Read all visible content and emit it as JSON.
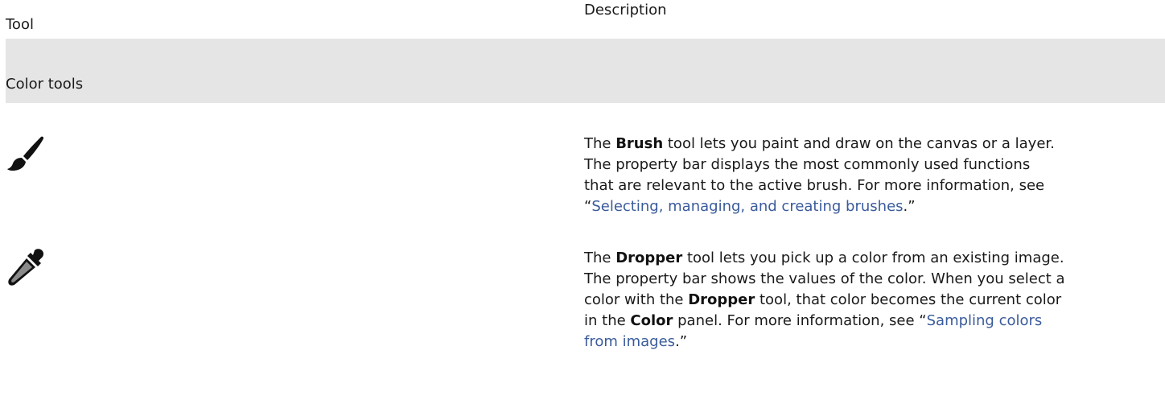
{
  "table": {
    "headers": {
      "tool": "Tool",
      "description": "Description"
    },
    "section": {
      "title": "Color tools"
    },
    "rows": [
      {
        "icon": "brush-icon",
        "lines": [
          {
            "pre": "The ",
            "tool": "Brush",
            "post": " tool lets you paint and draw on the canvas or a layer."
          },
          {
            "text": "The property bar displays the most commonly used functions"
          },
          {
            "text": "that are relevant to the active brush. For more information, see"
          },
          {
            "pre": "“",
            "link": "Selecting, managing, and creating brushes",
            "post": ".”"
          }
        ]
      },
      {
        "icon": "dropper-icon",
        "lines": [
          {
            "pre": "The ",
            "tool": "Dropper",
            "post": " tool lets you pick up a color from an existing image."
          },
          {
            "text": "The property bar shows the values of the color. When you select a"
          },
          {
            "pre": "color with the ",
            "tool": "Dropper",
            "post": " tool, that color becomes the current color"
          },
          {
            "pre": "in the ",
            "panel": "Color",
            "post": " panel. For more information, see “",
            "link": "Sampling colors"
          },
          {
            "link": "from images",
            "post": ".”"
          }
        ]
      }
    ]
  },
  "colors": {
    "section_background": "#e5e5e5",
    "link": "#3a5b9b",
    "text": "#1a1a1a"
  }
}
